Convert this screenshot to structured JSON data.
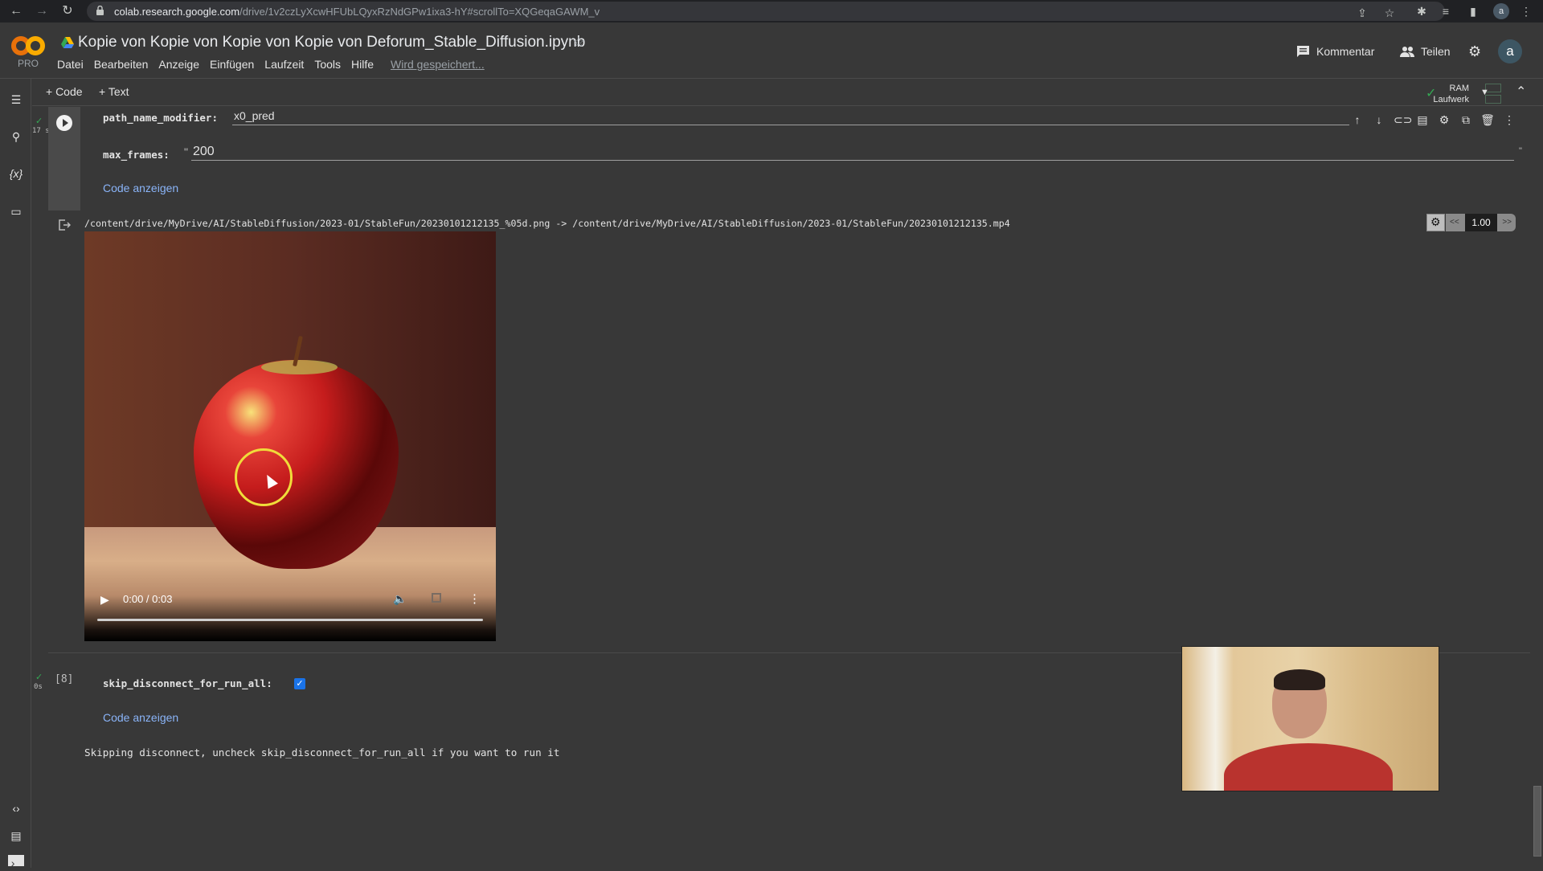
{
  "browser": {
    "url_host": "colab.research.google.com",
    "url_path": "/drive/1v2czLyXcwHFUbLQyxRzNdGPw1ixa3-hY#scrollTo=XQGeqaGAWM_v",
    "profile_initial": "a"
  },
  "header": {
    "brand_badge": "PRO",
    "notebook_title": "Kopie von Kopie von Kopie von Kopie von Deforum_Stable_Diffusion.ipynb",
    "menu": [
      "Datei",
      "Bearbeiten",
      "Anzeige",
      "Einfügen",
      "Laufzeit",
      "Tools",
      "Hilfe"
    ],
    "save_status": "Wird gespeichert...",
    "comment_label": "Kommentar",
    "share_label": "Teilen",
    "avatar_initial": "a"
  },
  "toolbar": {
    "add_code": "+ Code",
    "add_text": "+ Text",
    "ram_label": "RAM",
    "disk_label": "Laufwerk",
    "status_color": "#34a853"
  },
  "cell1": {
    "exec_time": "17 s",
    "fields": [
      {
        "label": "path_name_modifier:",
        "value": "x0_pred"
      },
      {
        "label": "max_frames:",
        "prefix": "\"",
        "value": "200"
      }
    ],
    "show_code": "Code anzeigen",
    "output_path": "/content/drive/MyDrive/AI/StableDiffusion/2023-01/StableFun/20230101212135_%05d.png -> /content/drive/MyDrive/AI/StableDiffusion/2023-01/StableFun/20230101212135.mp4",
    "speed": {
      "prev": "<<",
      "value": "1.00",
      "next": ">>"
    },
    "video": {
      "time": "0:00 / 0:03",
      "progress": 0
    }
  },
  "cell2": {
    "exec_count": "[8]",
    "exec_time": "0s",
    "field_label": "skip_disconnect_for_run_all:",
    "checked": true,
    "show_code": "Code anzeigen",
    "output": "Skipping disconnect, uncheck skip_disconnect_for_run_all if you want to run it"
  },
  "colors": {
    "link": "#8ab4f8",
    "accent": "#1a73e8",
    "logo": "#f9ab00"
  }
}
